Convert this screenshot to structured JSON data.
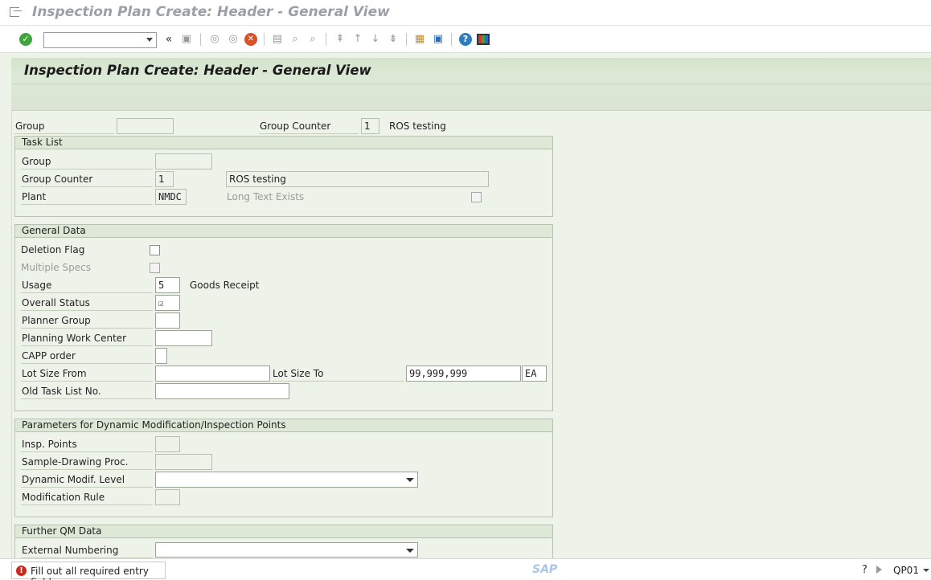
{
  "window": {
    "title": "Inspection Plan Create: Header - General View"
  },
  "toolbar": {
    "command_value": "",
    "icons": [
      "enter-icon",
      "back-double-icon",
      "save-icon",
      "back-icon",
      "exit-icon",
      "cancel-icon",
      "print-icon",
      "find-icon",
      "find-next-icon",
      "first-page-icon",
      "previous-page-icon",
      "next-page-icon",
      "last-page-icon",
      "create-session-icon",
      "shortcut-icon",
      "help-icon",
      "customize-layout-icon"
    ]
  },
  "header": {
    "title": "Inspection Plan Create: Header - General View"
  },
  "top_fields": {
    "group_label": "Group",
    "group_value": "",
    "group_counter_label": "Group Counter",
    "group_counter_value": "1",
    "description": "ROS testing"
  },
  "task_list": {
    "title": "Task List",
    "group_label": "Group",
    "group_value": "",
    "group_counter_label": "Group Counter",
    "group_counter_value": "1",
    "description_value": "ROS testing",
    "plant_label": "Plant",
    "plant_value": "NMDC",
    "long_text_label": "Long Text Exists",
    "long_text_checked": false
  },
  "general_data": {
    "title": "General Data",
    "deletion_flag_label": "Deletion Flag",
    "deletion_flag_checked": false,
    "multiple_specs_label": "Multiple Specs",
    "multiple_specs_checked": false,
    "usage_label": "Usage",
    "usage_value": "5",
    "usage_text": "Goods Receipt",
    "overall_status_label": "Overall Status",
    "overall_status_mark": "☑",
    "planner_group_label": "Planner Group",
    "planner_group_value": "",
    "planning_work_center_label": "Planning Work Center",
    "planning_work_center_value": "",
    "capp_order_label": "CAPP order",
    "capp_order_value": "",
    "lot_size_from_label": "Lot Size From",
    "lot_size_from_value": "",
    "lot_size_to_label": "Lot Size To",
    "lot_size_to_value": "99,999,999",
    "lot_size_unit": "EA",
    "old_task_list_label": "Old Task List No.",
    "old_task_list_value": ""
  },
  "dynamic_mod": {
    "title": "Parameters for Dynamic Modification/Inspection Points",
    "insp_points_label": "Insp. Points",
    "insp_points_value": "",
    "sample_drawing_label": "Sample-Drawing Proc.",
    "sample_drawing_value": "",
    "dynamic_level_label": "Dynamic Modif. Level",
    "dynamic_level_value": "",
    "modification_rule_label": "Modification Rule",
    "modification_rule_value": ""
  },
  "further_qm": {
    "title": "Further QM Data",
    "external_numbering_label": "External Numbering",
    "external_numbering_value": ""
  },
  "status": {
    "message": "Fill out all required entry fields",
    "logo": "SAP",
    "transaction": "QP01"
  }
}
